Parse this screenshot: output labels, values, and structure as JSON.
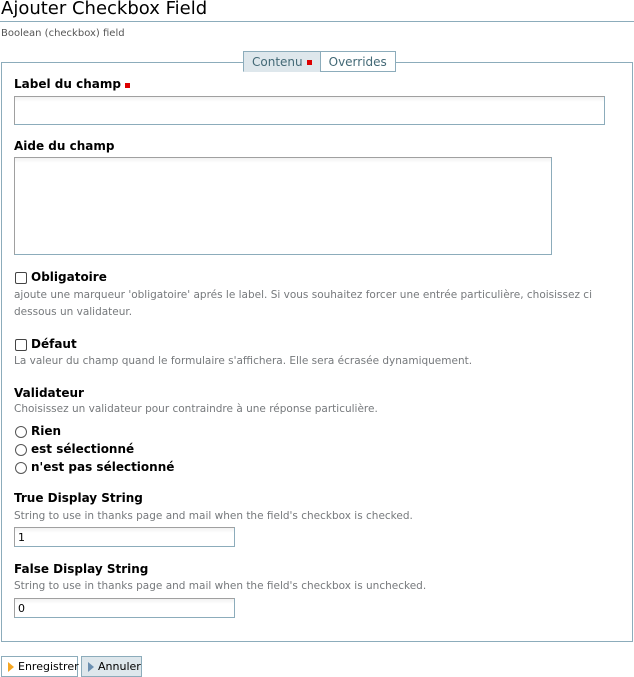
{
  "header": {
    "title": "Ajouter Checkbox Field",
    "subtitle": "Boolean (checkbox) field"
  },
  "tabs": [
    {
      "label": "Contenu",
      "selected": true,
      "required": true
    },
    {
      "label": "Overrides",
      "selected": false
    }
  ],
  "form": {
    "field_label": {
      "label": "Label du champ",
      "required": true,
      "value": ""
    },
    "field_help": {
      "label": "Aide du champ",
      "value": ""
    },
    "required": {
      "label": "Obligatoire",
      "checked": false,
      "help": "ajoute une marqueur 'obligatoire' aprés le label. Si vous souhaitez forcer une entrée particulière, choisissez ci dessous un validateur."
    },
    "default": {
      "label": "Défaut",
      "checked": false,
      "help": "La valeur du champ quand le formulaire s'affichera. Elle sera écrasée dynamiquement."
    },
    "validator": {
      "label": "Validateur",
      "help": "Choisissez un validateur pour contraindre à une réponse particulière.",
      "options": [
        "Rien",
        "est sélectionné",
        "n'est pas sélectionné"
      ],
      "selected": null
    },
    "true_display": {
      "label": "True Display String",
      "help": "String to use in thanks page and mail when the field's checkbox is checked.",
      "value": "1"
    },
    "false_display": {
      "label": "False Display String",
      "help": "String to use in thanks page and mail when the field's checkbox is unchecked.",
      "value": "0"
    }
  },
  "buttons": {
    "save": "Enregistrer",
    "cancel": "Annuler"
  },
  "colors": {
    "border": "#8cacbb",
    "tab_selected_bg": "#dee7ec",
    "required_marker": "#dd0000",
    "help_text": "#76797c",
    "button_icon": "#f5a623"
  }
}
